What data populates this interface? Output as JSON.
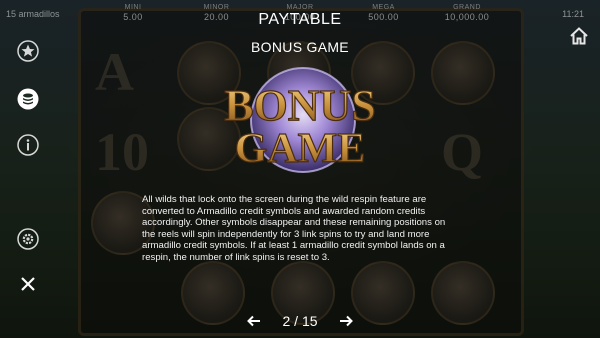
{
  "status_bar": {
    "balance_text": "15 armadillos",
    "clock": "11:21"
  },
  "jackpots": [
    {
      "label": "MINI",
      "value": "5.00"
    },
    {
      "label": "MINOR",
      "value": "20.00"
    },
    {
      "label": "MAJOR",
      "value": "100.00"
    },
    {
      "label": "MEGA",
      "value": "500.00"
    },
    {
      "label": "GRAND",
      "value": "10,000.00"
    }
  ],
  "paytable": {
    "title": "PAYTABLE",
    "subtitle": "BONUS GAME",
    "logo_text_line1": "BONUS",
    "logo_text_line2": "GAME",
    "description": "All wilds that lock onto the screen during the wild respin feature are converted to Armadillo credit symbols and awarded random credits accordingly. Other symbols disappear and these remaining positions on the reels will spin independently for 3 link spins to try and land more armadillo credit symbols. If at least 1 armadillo credit symbol lands on a respin, the number of link spins is reset to 3."
  },
  "pager": {
    "current_page": "2",
    "separator": "/",
    "total_pages": "15"
  },
  "side_menu": {
    "icons": [
      "star-icon",
      "coin-stack-icon",
      "info-icon",
      "gear-icon",
      "close-icon"
    ]
  },
  "colors": {
    "logo_gold": "#c8913c",
    "logo_glow": "#b9a4e6",
    "text": "#ffffff"
  }
}
